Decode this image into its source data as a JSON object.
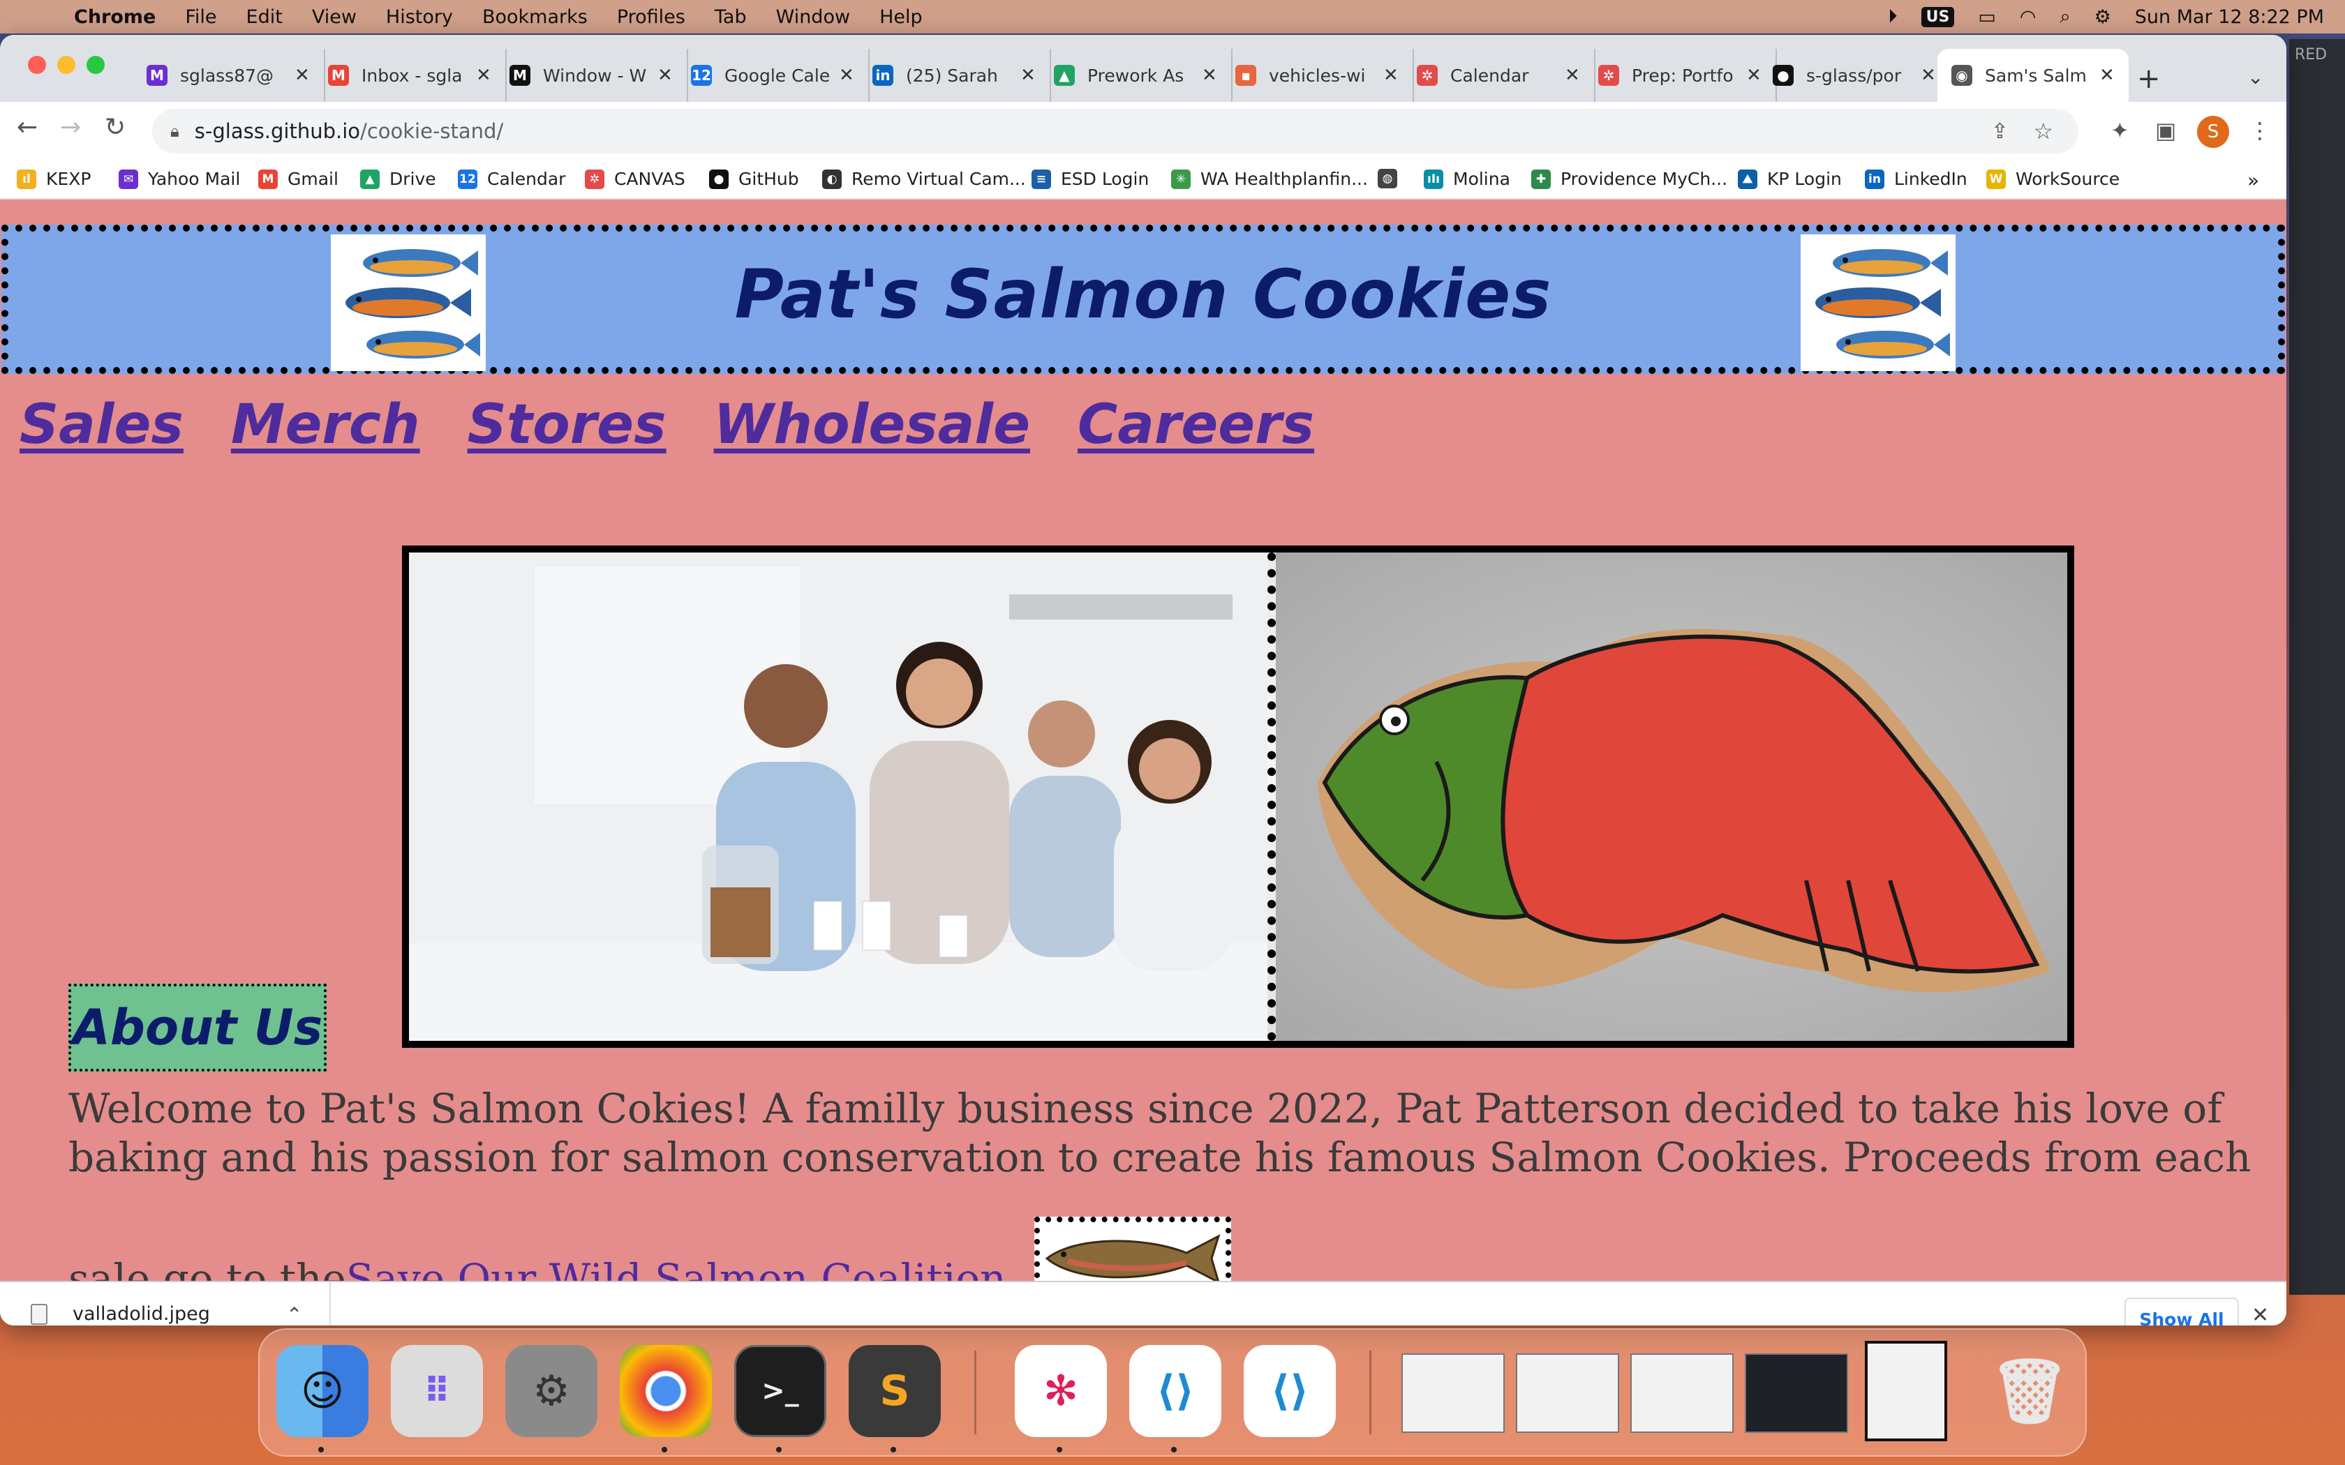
{
  "menubar": {
    "app": "Chrome",
    "items": [
      "File",
      "Edit",
      "View",
      "History",
      "Bookmarks",
      "Profiles",
      "Tab",
      "Window",
      "Help"
    ],
    "input_source": "US",
    "datetime": "Sun Mar 12  8:22 PM"
  },
  "tabs": [
    {
      "title": "sglass87@",
      "fav": "M",
      "color": "#6b2fd0"
    },
    {
      "title": "Inbox - sgla",
      "fav": "M",
      "color": "#ea4335"
    },
    {
      "title": "Window - W",
      "fav": "M",
      "color": "#111111"
    },
    {
      "title": "Google Cale",
      "fav": "12",
      "color": "#1a73e8"
    },
    {
      "title": "(25) Sarah",
      "fav": "in",
      "color": "#0a66c2"
    },
    {
      "title": "Prework As",
      "fav": "▲",
      "color": "#1fa463"
    },
    {
      "title": "vehicles-wi",
      "fav": "▪",
      "color": "#e8663d"
    },
    {
      "title": "Calendar",
      "fav": "✲",
      "color": "#e34b4b"
    },
    {
      "title": "Prep: Portfo",
      "fav": "✲",
      "color": "#e34b4b"
    },
    {
      "title": "s-glass/por",
      "fav": "●",
      "color": "#111111"
    },
    {
      "title": "Sam's Salm",
      "fav": "◉",
      "color": "#555555"
    }
  ],
  "address": {
    "host": "s-glass.github.io",
    "path": "/cookie-stand/"
  },
  "bookmarks": [
    {
      "label": "KEXP",
      "icon": "bars",
      "color": "#f2b01e"
    },
    {
      "label": "Yahoo Mail",
      "icon": "✉",
      "color": "#6b2fd0"
    },
    {
      "label": "Gmail",
      "icon": "M",
      "color": "#ea4335"
    },
    {
      "label": "Drive",
      "icon": "▲",
      "color": "#1fa463"
    },
    {
      "label": "Calendar",
      "icon": "12",
      "color": "#1a73e8"
    },
    {
      "label": "CANVAS",
      "icon": "✲",
      "color": "#e34b4b"
    },
    {
      "label": "GitHub",
      "icon": "●",
      "color": "#111111"
    },
    {
      "label": "Remo Virtual Cam...",
      "icon": "◐",
      "color": "#333333"
    },
    {
      "label": "ESD Login",
      "icon": "≡",
      "color": "#1b5fa8"
    },
    {
      "label": "WA Healthplanfin...",
      "icon": "✳",
      "color": "#3a9a4a"
    },
    {
      "label": "",
      "icon": "◍",
      "color": "#444444"
    },
    {
      "label": "Molina",
      "icon": "ıIı",
      "color": "#0a8ea6"
    },
    {
      "label": "Providence MyCh...",
      "icon": "✚",
      "color": "#2e8a4a"
    },
    {
      "label": "KP Login",
      "icon": "⛰",
      "color": "#0b5fa5"
    },
    {
      "label": "LinkedIn",
      "icon": "in",
      "color": "#0a66c2"
    },
    {
      "label": "WorkSource",
      "icon": "W",
      "color": "#e8b400"
    }
  ],
  "page": {
    "title": "Pat's Salmon Cookies",
    "nav": [
      "Sales",
      "Merch",
      "Stores",
      "Wholesale",
      "Careers"
    ],
    "about_heading": "About Us",
    "about_line1": "Welcome to Pat's Salmon Cokies! A familly business since 2022, Pat Patterson decided to take his love of",
    "about_line2": "baking and his passion for salmon conservation to create his famous Salmon Cookies. Proceeds from each",
    "about_line3_prefix": "sale go to the ",
    "about_link": "Save Our Wild Salmon Coalition."
  },
  "download": {
    "filename": "valladolid.jpeg",
    "show_all": "Show All"
  },
  "bg_window_text": "RED",
  "colors": {
    "page_bg": "#e58c8c",
    "header_bg": "#7ea7ea",
    "title": "#0c1c6b",
    "nav_link": "#4e2c9e",
    "about_bg": "#6fc18f"
  }
}
